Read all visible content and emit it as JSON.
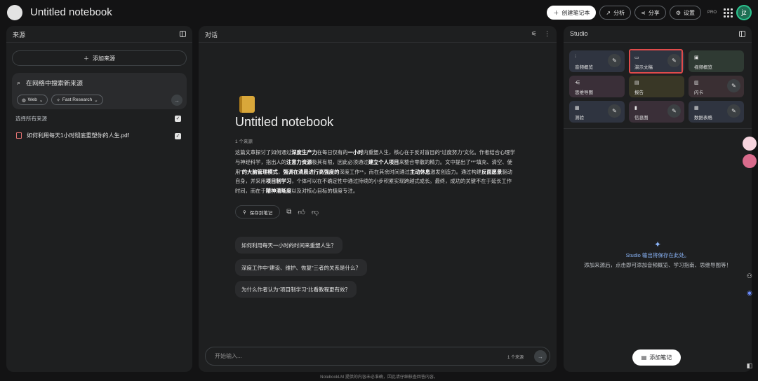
{
  "app": {
    "title": "Untitled notebook",
    "avatar": "jz",
    "pro": "PRO"
  },
  "topbar": {
    "create_notebook": "创建笔记本",
    "analytics": "分析",
    "share": "分享",
    "settings": "设置"
  },
  "sources_panel": {
    "title": "来源",
    "add_source": "添加来源",
    "search_placeholder": "在网络中搜索新来源",
    "web_chip": "Web",
    "research_chip": "Fast Research",
    "select_all": "选择所有来源",
    "items": [
      {
        "name": "如何利用每天1小时彻底重塑你的人生.pdf"
      }
    ]
  },
  "chat_panel": {
    "title": "对话",
    "notebook_title": "Untitled notebook",
    "source_count": "1 个来源",
    "summary_html": "这篇文章探讨了如何通过<b>深度生产力</b>在每日仅有的<b>一小时</b>内重塑人生，核心在于反对盲目的“过度努力”文化。作者结合心理学与神经科学，指出人的<b>注意力资源</b>极其有限，因此必须通过<b>建立个人项目</b>来整合零散的精力。文中提出了**“填充、清空、使用”<b>的大脑管理模式</b>，<b>强调在清晨进行高强度的</b>深度工作**，而在其余时间通过<b>主动休息</b>激发创造力。通过构建<b>反面愿景</b>驱动自身，并采用<b>项目制学习</b>，个体可以在不确定性中通过持续的小步积累实现跨越式成长。最终，成功的关键不在于延长工作时间，而在于<b>精神清晰度</b>以及对核心目标的极度专注。",
    "save_note": "保存到笔记",
    "suggestions": [
      "如何利用每天一小时的时间来重塑人生？",
      "深度工作中“建设、维护、恢复”三者的关系是什么？",
      "为什么作者认为“项目制学习”比看教程更有效？"
    ],
    "input_placeholder": "开始输入...",
    "input_source_count": "1 个来源"
  },
  "studio_panel": {
    "title": "Studio",
    "tiles": [
      {
        "label": "音频概览",
        "icon": "waveform-icon",
        "color": "#2f3440",
        "pen": true
      },
      {
        "label": "演示文稿",
        "icon": "slides-icon",
        "color": "#2f3440",
        "pen": true
      },
      {
        "label": "视频概览",
        "icon": "video-icon",
        "color": "#2f3a33",
        "pen": false
      },
      {
        "label": "思维导图",
        "icon": "mindmap-icon",
        "color": "#3a2f38",
        "pen": false
      },
      {
        "label": "报告",
        "icon": "report-icon",
        "color": "#393726",
        "pen": false
      },
      {
        "label": "闪卡",
        "icon": "flashcard-icon",
        "color": "#3a2f33",
        "pen": true
      },
      {
        "label": "测验",
        "icon": "quiz-icon",
        "color": "#2f3440",
        "pen": true
      },
      {
        "label": "信息图",
        "icon": "infographic-icon",
        "color": "#3a2f38",
        "pen": true
      },
      {
        "label": "数据表格",
        "icon": "table-icon",
        "color": "#2f3440",
        "pen": true
      }
    ],
    "empty_title": "Studio 输出将保存在此处。",
    "empty_subtitle": "添加来源后，点击即可添加音频概览、学习指南、思维导图等！",
    "add_note": "添加笔记"
  },
  "footer": "NotebookLM 提供的内容未必准确，因此请仔细核查回答内容。"
}
